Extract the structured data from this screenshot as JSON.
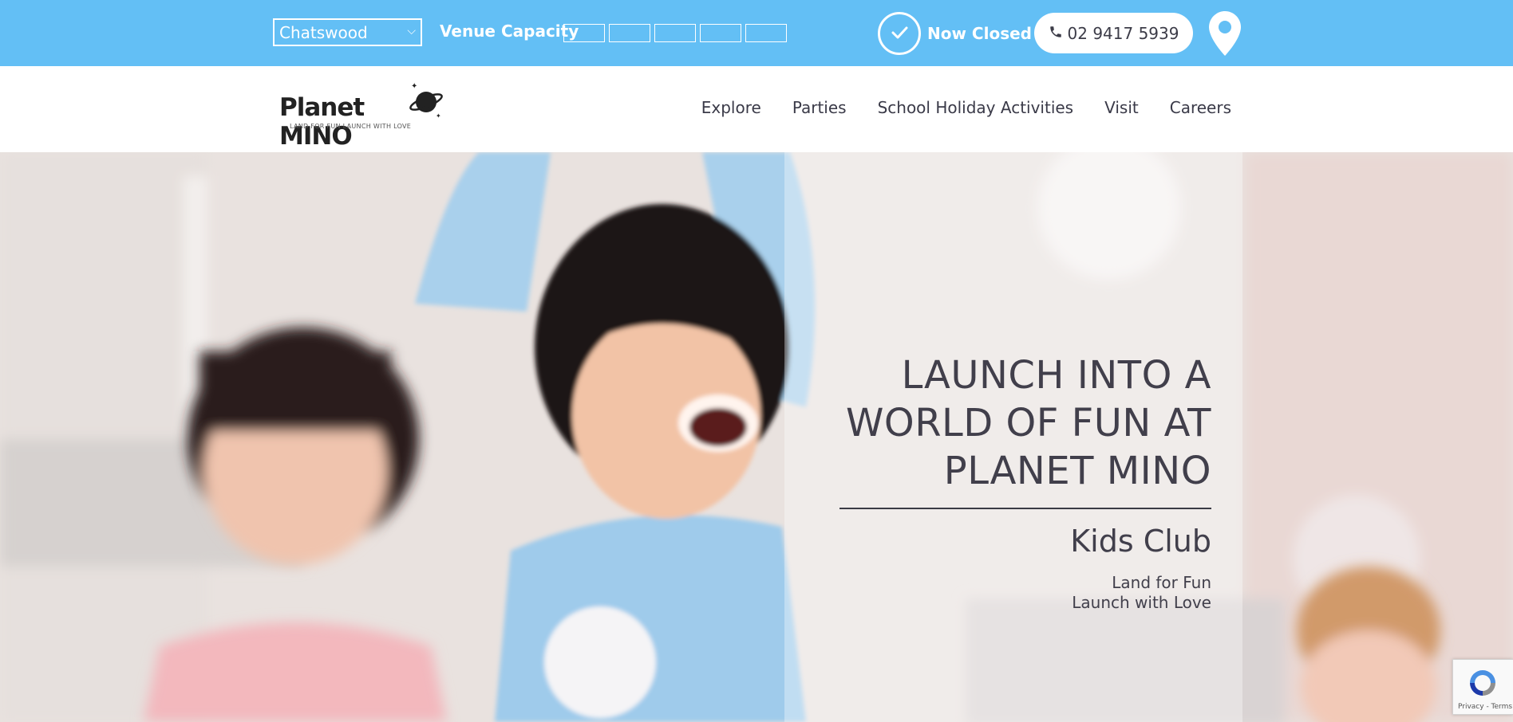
{
  "topbar": {
    "location": "Chatswood",
    "capacity_label": "Venue Capacity",
    "status": "Now Closed",
    "phone": "02 9417 5939"
  },
  "logo": {
    "title": "Planet MINO",
    "tagline": "LAND FOR FUN  LAUNCH WITH LOVE"
  },
  "nav": {
    "items": [
      "Explore",
      "Parties",
      "School Holiday Activities",
      "Visit",
      "Careers"
    ]
  },
  "hero": {
    "title_line1": "LAUNCH INTO A",
    "title_line2": "WORLD OF FUN AT",
    "title_line3": "PLANET MINO",
    "subtitle": "Kids Club",
    "tagline1": "Land for Fun",
    "tagline2": "Launch with Love"
  },
  "recaptcha": {
    "text": "Privacy - Terms"
  },
  "colors": {
    "topbar": "#63bff5",
    "text_dark": "#413f4b"
  },
  "icons": [
    "clock-icon",
    "phone-icon",
    "location-pin-icon",
    "chevron-down-icon",
    "recaptcha-icon"
  ]
}
